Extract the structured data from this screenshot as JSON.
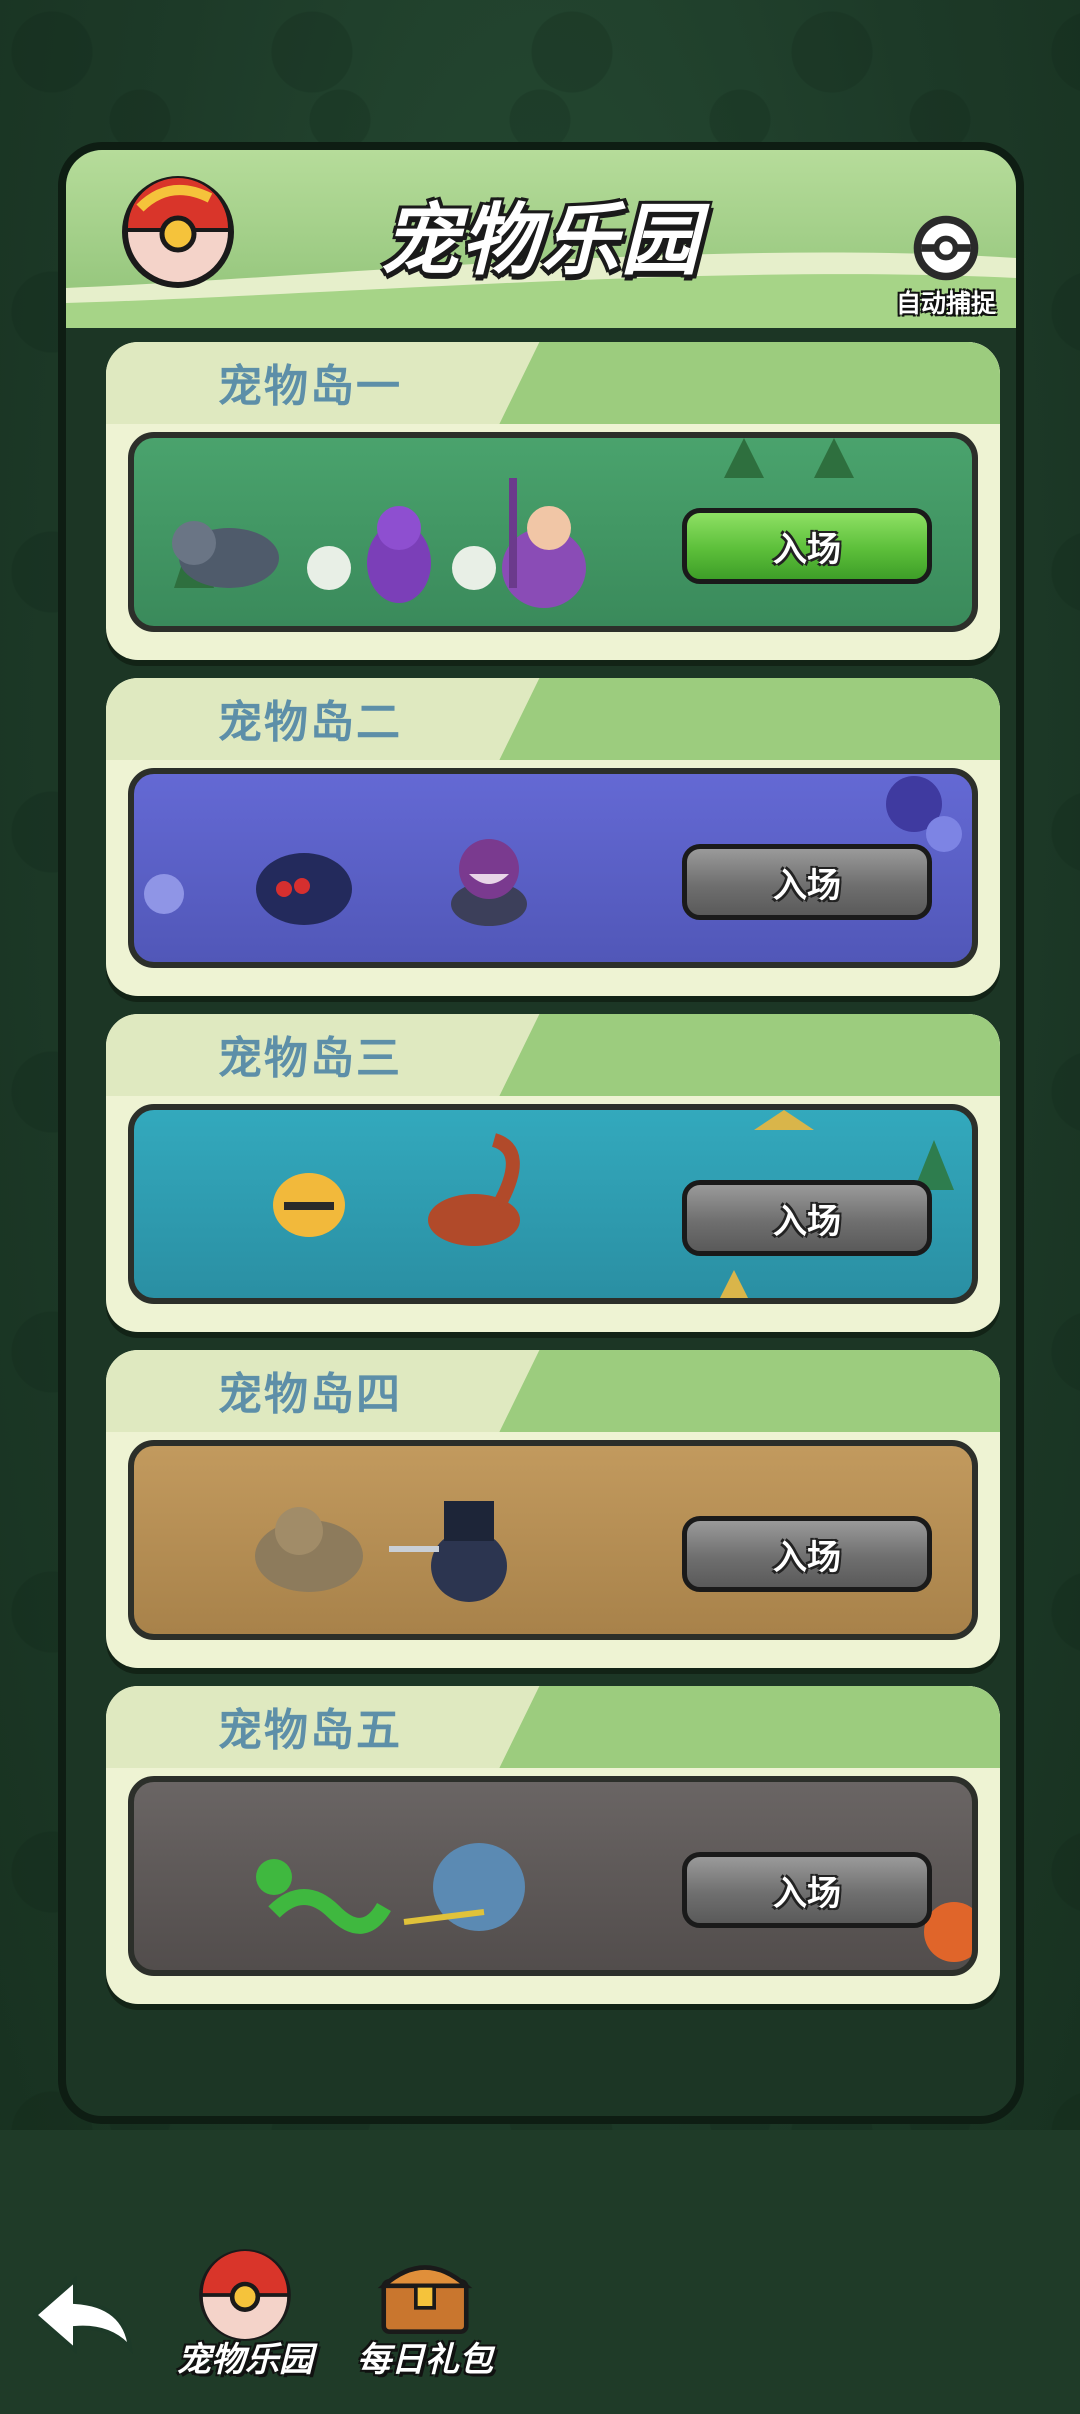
{
  "header": {
    "title": "宠物乐园",
    "auto_capture_label": "自动捕捉"
  },
  "islands": [
    {
      "name": "宠物岛一",
      "button": "入场",
      "state": "active",
      "scene_color": "#3f8f61"
    },
    {
      "name": "宠物岛二",
      "button": "入场",
      "state": "locked",
      "scene_color": "#5b5fc7"
    },
    {
      "name": "宠物岛三",
      "button": "入场",
      "state": "locked",
      "scene_color": "#2f9db0"
    },
    {
      "name": "宠物岛四",
      "button": "入场",
      "state": "locked",
      "scene_color": "#b58a52"
    },
    {
      "name": "宠物岛五",
      "button": "入场",
      "state": "locked",
      "scene_color": "#5d5a5a"
    }
  ],
  "bottom_nav": {
    "back_icon": "back-arrow-icon",
    "items": [
      {
        "label": "宠物乐园",
        "icon": "pet-ball-icon"
      },
      {
        "label": "每日礼包",
        "icon": "treasure-chest-icon"
      }
    ]
  },
  "colors": {
    "enter_active": "#5cbf3a",
    "enter_locked": "#6f6f6f",
    "island_name": "#5d8fa8"
  }
}
